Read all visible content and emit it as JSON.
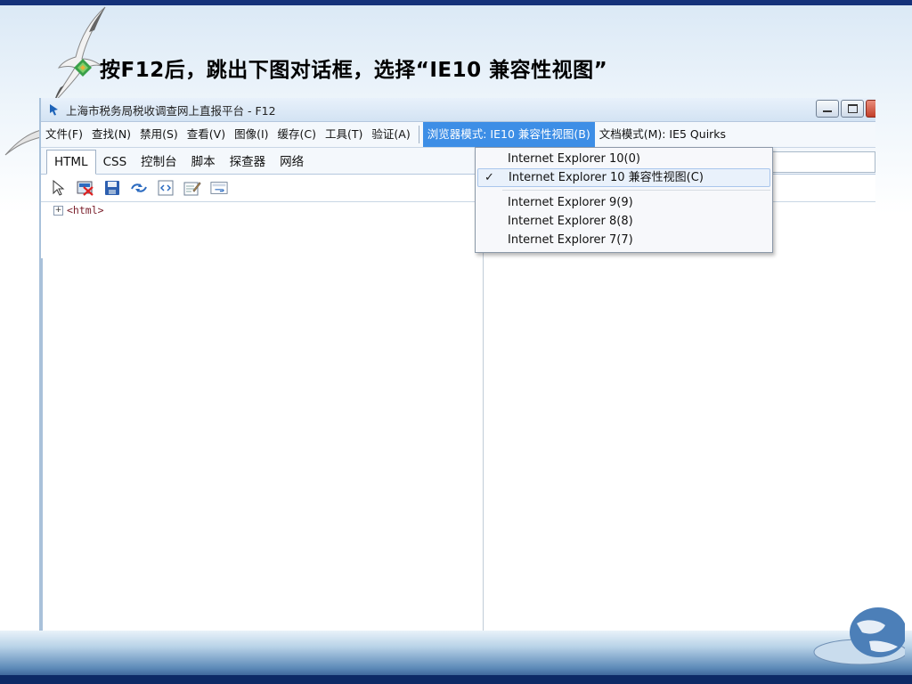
{
  "slide": {
    "instruction": "按F12后，跳出下图对话框，选择“IE10 兼容性视图”"
  },
  "window": {
    "title": "上海市税务局税收调查网上直报平台 - F12"
  },
  "menubar": {
    "items": [
      "文件(F)",
      "查找(N)",
      "禁用(S)",
      "查看(V)",
      "图像(I)",
      "缓存(C)",
      "工具(T)",
      "验证(A)"
    ],
    "browser_mode": "浏览器模式: IE10 兼容性视图(B)",
    "document_mode": "文档模式(M): IE5 Quirks"
  },
  "tabs": [
    "HTML",
    "CSS",
    "控制台",
    "脚本",
    "探查器",
    "网络"
  ],
  "toolbar": {
    "icons": [
      "select-element-icon",
      "clear-icon",
      "save-icon",
      "refresh-icon",
      "view-source-icon",
      "edit-icon",
      "word-wrap-icon"
    ]
  },
  "tree": {
    "root_label": "<html>",
    "expander": "+"
  },
  "dropdown": {
    "items": [
      {
        "label": "Internet Explorer 10(0)",
        "checked": false
      },
      {
        "label": "Internet Explorer 10 兼容性视图(C)",
        "checked": true
      },
      {
        "label": "Internet Explorer 9(9)",
        "checked": false
      },
      {
        "label": "Internet Explorer 8(8)",
        "checked": false
      },
      {
        "label": "Internet Explorer 7(7)",
        "checked": false
      }
    ],
    "check_glyph": "✓"
  }
}
